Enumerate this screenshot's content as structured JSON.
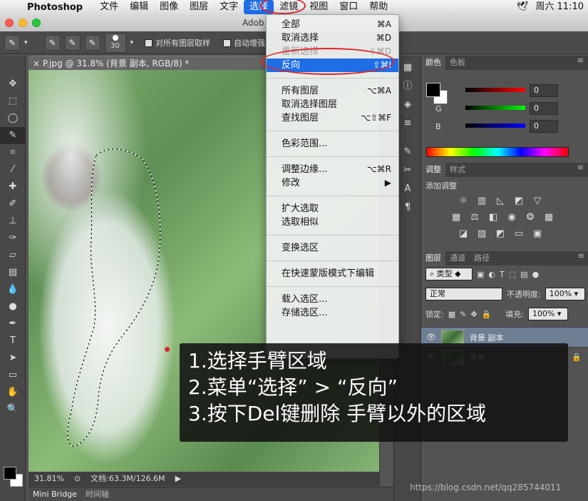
{
  "menubar": {
    "app_name": "Photoshop",
    "items": [
      "文件",
      "编辑",
      "图像",
      "图层",
      "文字",
      "选择",
      "滤镜",
      "视图",
      "窗口",
      "帮助"
    ],
    "active_item": "选择",
    "clock": "周六 11:10"
  },
  "window": {
    "title": "Adob"
  },
  "options_bar": {
    "brush_size": "30",
    "sample_all_label": "对所有图层取样",
    "auto_enhance_label": "自动增强"
  },
  "document": {
    "tab_title": "P.jpg @ 31.8% (背景 副本, RGB/8) *",
    "zoom": "31.81%",
    "doc_info": "文档:63.3M/126.6M"
  },
  "bottom_tabs": [
    "Mini Bridge",
    "时间轴"
  ],
  "select_menu": {
    "groups": [
      [
        {
          "label": "全部",
          "shortcut": "⌘A",
          "state": "normal"
        },
        {
          "label": "取消选择",
          "shortcut": "⌘D",
          "state": "normal"
        },
        {
          "label": "重新选择",
          "shortcut": "⇧⌘D",
          "state": "disabled"
        },
        {
          "label": "反向",
          "shortcut": "⇧⌘I",
          "state": "highlighted"
        }
      ],
      [
        {
          "label": "所有图层",
          "shortcut": "⌥⌘A",
          "state": "normal"
        },
        {
          "label": "取消选择图层",
          "shortcut": "",
          "state": "normal"
        },
        {
          "label": "查找图层",
          "shortcut": "⌥⇧⌘F",
          "state": "normal"
        }
      ],
      [
        {
          "label": "色彩范围...",
          "shortcut": "",
          "state": "normal"
        }
      ],
      [
        {
          "label": "调整边缘...",
          "shortcut": "⌥⌘R",
          "state": "normal"
        },
        {
          "label": "修改",
          "shortcut": "▶",
          "state": "normal"
        }
      ],
      [
        {
          "label": "扩大选取",
          "shortcut": "",
          "state": "normal"
        },
        {
          "label": "选取相似",
          "shortcut": "",
          "state": "normal"
        }
      ],
      [
        {
          "label": "变换选区",
          "shortcut": "",
          "state": "normal"
        }
      ],
      [
        {
          "label": "在快速蒙版模式下编辑",
          "shortcut": "",
          "state": "normal"
        }
      ],
      [
        {
          "label": "载入选区...",
          "shortcut": "",
          "state": "normal"
        },
        {
          "label": "存储选区...",
          "shortcut": "",
          "state": "normal"
        }
      ]
    ]
  },
  "color_panel": {
    "tabs": [
      "颜色",
      "色板"
    ],
    "channels": [
      {
        "label": "R",
        "value": "0",
        "color": "#ff0000"
      },
      {
        "label": "G",
        "value": "0",
        "color": "#00ff00"
      },
      {
        "label": "B",
        "value": "0",
        "color": "#0000ff"
      }
    ]
  },
  "adjustments_panel": {
    "tabs": [
      "调整",
      "样式"
    ],
    "heading": "添加调整"
  },
  "layers_panel": {
    "tabs": [
      "图层",
      "通道",
      "路径"
    ],
    "filter_label": "类型",
    "blend_mode": "正常",
    "opacity_label": "不透明度:",
    "opacity": "100%",
    "lock_label": "锁定:",
    "fill_label": "填充:",
    "fill": "100%",
    "layers": [
      {
        "name": "背景 副本",
        "selected": true
      },
      {
        "name": "背景",
        "selected": false
      }
    ]
  },
  "annotation": {
    "lines": [
      "1.选择手臂区域",
      "2.菜单“选择” > “反向”",
      "3.按下Del键删除 手臂以外的区域"
    ]
  },
  "watermark": "https://blog.csdn.net/qq285744011",
  "colors": {
    "menu_highlight": "#1f6ee6",
    "annotation_red": "#e0242a",
    "panel_bg": "#535353"
  }
}
